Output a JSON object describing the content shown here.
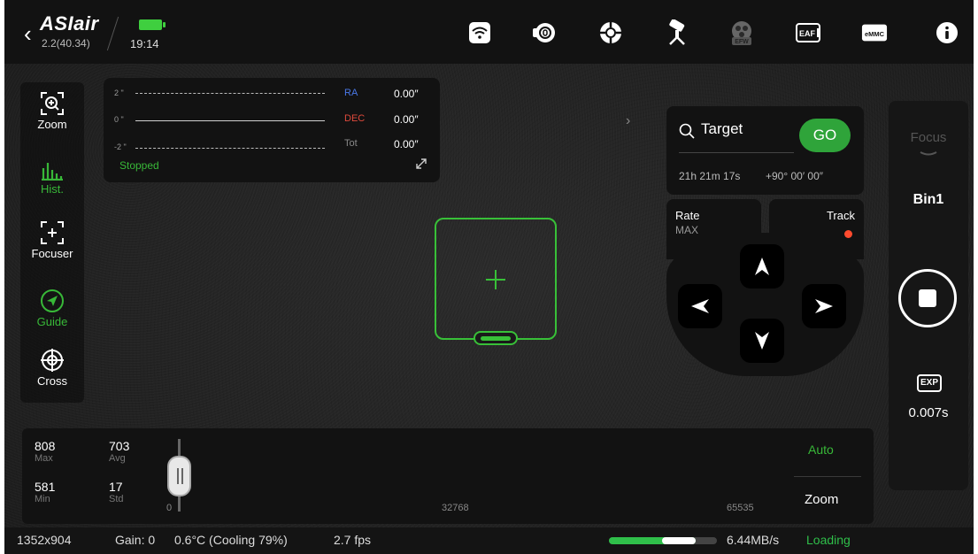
{
  "app": {
    "brand": "ASIair",
    "version": "2.2(40.34)",
    "time": "19:14"
  },
  "topbar": {
    "icons": [
      {
        "name": "wifi-icon"
      },
      {
        "name": "camera-icon"
      },
      {
        "name": "guide-camera-icon"
      },
      {
        "name": "telescope-mount-icon"
      },
      {
        "name": "efw-filter-wheel-icon",
        "label": "EFW"
      },
      {
        "name": "eaf-focuser-icon",
        "label": "EAF"
      },
      {
        "name": "emmc-storage-icon",
        "label": "eMMC"
      },
      {
        "name": "info-icon"
      }
    ]
  },
  "left_tools": [
    {
      "name": "zoom-tool",
      "icon": "zoom-icon",
      "label": "Zoom",
      "active": false
    },
    {
      "name": "histogram-tool",
      "icon": "histogram-icon",
      "label": "Hist.",
      "active": true
    },
    {
      "name": "focuser-tool",
      "icon": "focuser-icon",
      "label": "Focuser",
      "active": false
    },
    {
      "name": "guide-tool",
      "icon": "guide-icon",
      "label": "Guide",
      "active": true
    },
    {
      "name": "cross-tool",
      "icon": "crosshair-icon",
      "label": "Cross",
      "active": false
    }
  ],
  "guide_graph": {
    "ticks": [
      "2 \"",
      "0 \"",
      "-2 \""
    ],
    "rows": [
      {
        "key": "RA",
        "value": "0.00″",
        "color": "#4a78e8"
      },
      {
        "key": "DEC",
        "value": "0.00″",
        "color": "#e04a3c"
      },
      {
        "key": "Tot",
        "value": "0.00″",
        "color": "#888888"
      }
    ],
    "status": "Stopped"
  },
  "target": {
    "label": "Target",
    "go": "GO",
    "ra": "21h 21m 17s",
    "dec": "+90° 00′ 00″"
  },
  "mount": {
    "rate_label": "Rate",
    "rate_value": "MAX",
    "track_label": "Track",
    "track_color": "#ff4b2e"
  },
  "right_rail": {
    "focus": "Focus",
    "bin": "Bin1",
    "exp_badge": "EXP",
    "exposure": "0.007s"
  },
  "histogram": {
    "max_value": "808",
    "max_label": "Max",
    "avg_value": "703",
    "avg_label": "Avg",
    "min_value": "581",
    "min_label": "Min",
    "std_value": "17",
    "std_label": "Std",
    "axis_left": "0",
    "axis_mid": "32768",
    "axis_right": "65535",
    "auto": "Auto",
    "zoom": "Zoom"
  },
  "status": {
    "resolution": "1352x904",
    "gain": "Gain: 0",
    "temperature": "0.6°C (Cooling 79%)",
    "fps": "2.7 fps",
    "transfer_rate": "6.44MB/s",
    "loading": "Loading",
    "progress": 0.8
  },
  "colors": {
    "accent_green": "#38b838",
    "go_green": "#2fa43a",
    "ra_blue": "#4a78e8",
    "dec_red": "#e04a3c"
  }
}
